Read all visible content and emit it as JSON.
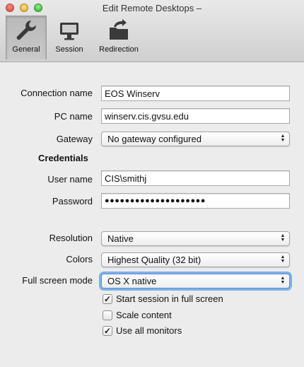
{
  "window": {
    "title": "Edit Remote Desktops –"
  },
  "toolbar": {
    "tabs": [
      {
        "label": "General",
        "icon": "wrench-icon",
        "selected": true
      },
      {
        "label": "Session",
        "icon": "monitor-icon",
        "selected": false
      },
      {
        "label": "Redirection",
        "icon": "folder-redirect-icon",
        "selected": false
      }
    ]
  },
  "form": {
    "connection_name": {
      "label": "Connection name",
      "value": "EOS Winserv"
    },
    "pc_name": {
      "label": "PC name",
      "value": "winserv.cis.gvsu.edu"
    },
    "gateway": {
      "label": "Gateway",
      "value": "No gateway configured"
    },
    "credentials_heading": "Credentials",
    "user_name": {
      "label": "User name",
      "value": "CIS\\smithj"
    },
    "password": {
      "label": "Password",
      "value": "●●●●●●●●●●●●●●●●●●●●"
    },
    "resolution": {
      "label": "Resolution",
      "value": "Native"
    },
    "colors": {
      "label": "Colors",
      "value": "Highest Quality (32 bit)"
    },
    "full_screen_mode": {
      "label": "Full screen mode",
      "value": "OS X native"
    },
    "checkboxes": [
      {
        "label": "Start session in full screen",
        "checked": true
      },
      {
        "label": "Scale content",
        "checked": false
      },
      {
        "label": "Use all monitors",
        "checked": true
      }
    ]
  },
  "colors": {
    "focus_ring": "#7fb0e8",
    "close": "#e0443e",
    "minimize": "#dea123",
    "maximize": "#1aab29"
  }
}
